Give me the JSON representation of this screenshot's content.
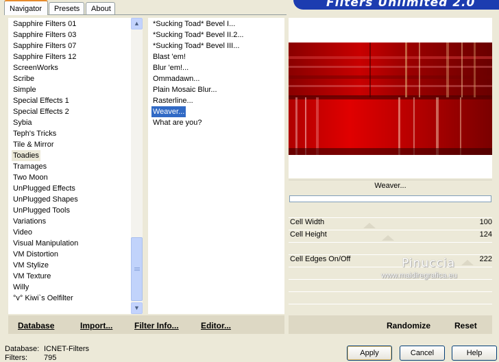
{
  "banner": {
    "title": "Filters Unlimited 2.0"
  },
  "tabs": [
    {
      "label": "Navigator",
      "active": true
    },
    {
      "label": "Presets",
      "active": false
    },
    {
      "label": "About",
      "active": false
    }
  ],
  "categories": {
    "items": [
      "Sapphire Filters 01",
      "Sapphire Filters 03",
      "Sapphire Filters 07",
      "Sapphire Filters 12",
      "ScreenWorks",
      "Scribe",
      "Simple",
      "Special Effects 1",
      "Special Effects 2",
      "Sybia",
      "Teph's Tricks",
      "Tile & Mirror",
      "Toadies",
      "Tramages",
      "Two Moon",
      "UnPlugged Effects",
      "UnPlugged Shapes",
      "UnPlugged Tools",
      "Variations",
      "Video",
      "Visual Manipulation",
      "VM Distortion",
      "VM Stylize",
      "VM Texture",
      "Willy",
      "°v° Kiwi`s Oelfilter"
    ],
    "selected": "Toadies"
  },
  "filters": {
    "items": [
      "*Sucking Toad*  Bevel I...",
      "*Sucking Toad*  Bevel II.2...",
      "*Sucking Toad*  Bevel III...",
      "Blast 'em!",
      "Blur 'em!...",
      "Ommadawn...",
      "Plain Mosaic Blur...",
      "Rasterline...",
      "Weaver...",
      "What are you?"
    ],
    "selected": "Weaver..."
  },
  "left_bar": {
    "database": "Database",
    "import": "Import...",
    "filter_info": "Filter Info...",
    "editor": "Editor..."
  },
  "right_bar": {
    "randomize": "Randomize",
    "reset": "Reset"
  },
  "filter_name": "Weaver...",
  "progress": 0,
  "params": [
    {
      "label": "Cell Width",
      "value": "100"
    },
    {
      "label": "Cell Height",
      "value": "124"
    },
    {
      "label": "Cell Edges On/Off",
      "value": "222"
    }
  ],
  "watermark": {
    "name": "Pinuccia",
    "url": "www.maidiregrafica.eu"
  },
  "status": {
    "database_label": "Database:",
    "database_value": "ICNET-Filters",
    "filters_label": "Filters:",
    "filters_value": "795"
  },
  "buttons": {
    "apply": "Apply",
    "cancel": "Cancel",
    "help": "Help"
  },
  "colors": {
    "accent": "#316ac5",
    "banner": "#1c3cb0",
    "preview_red": "#b40000"
  }
}
